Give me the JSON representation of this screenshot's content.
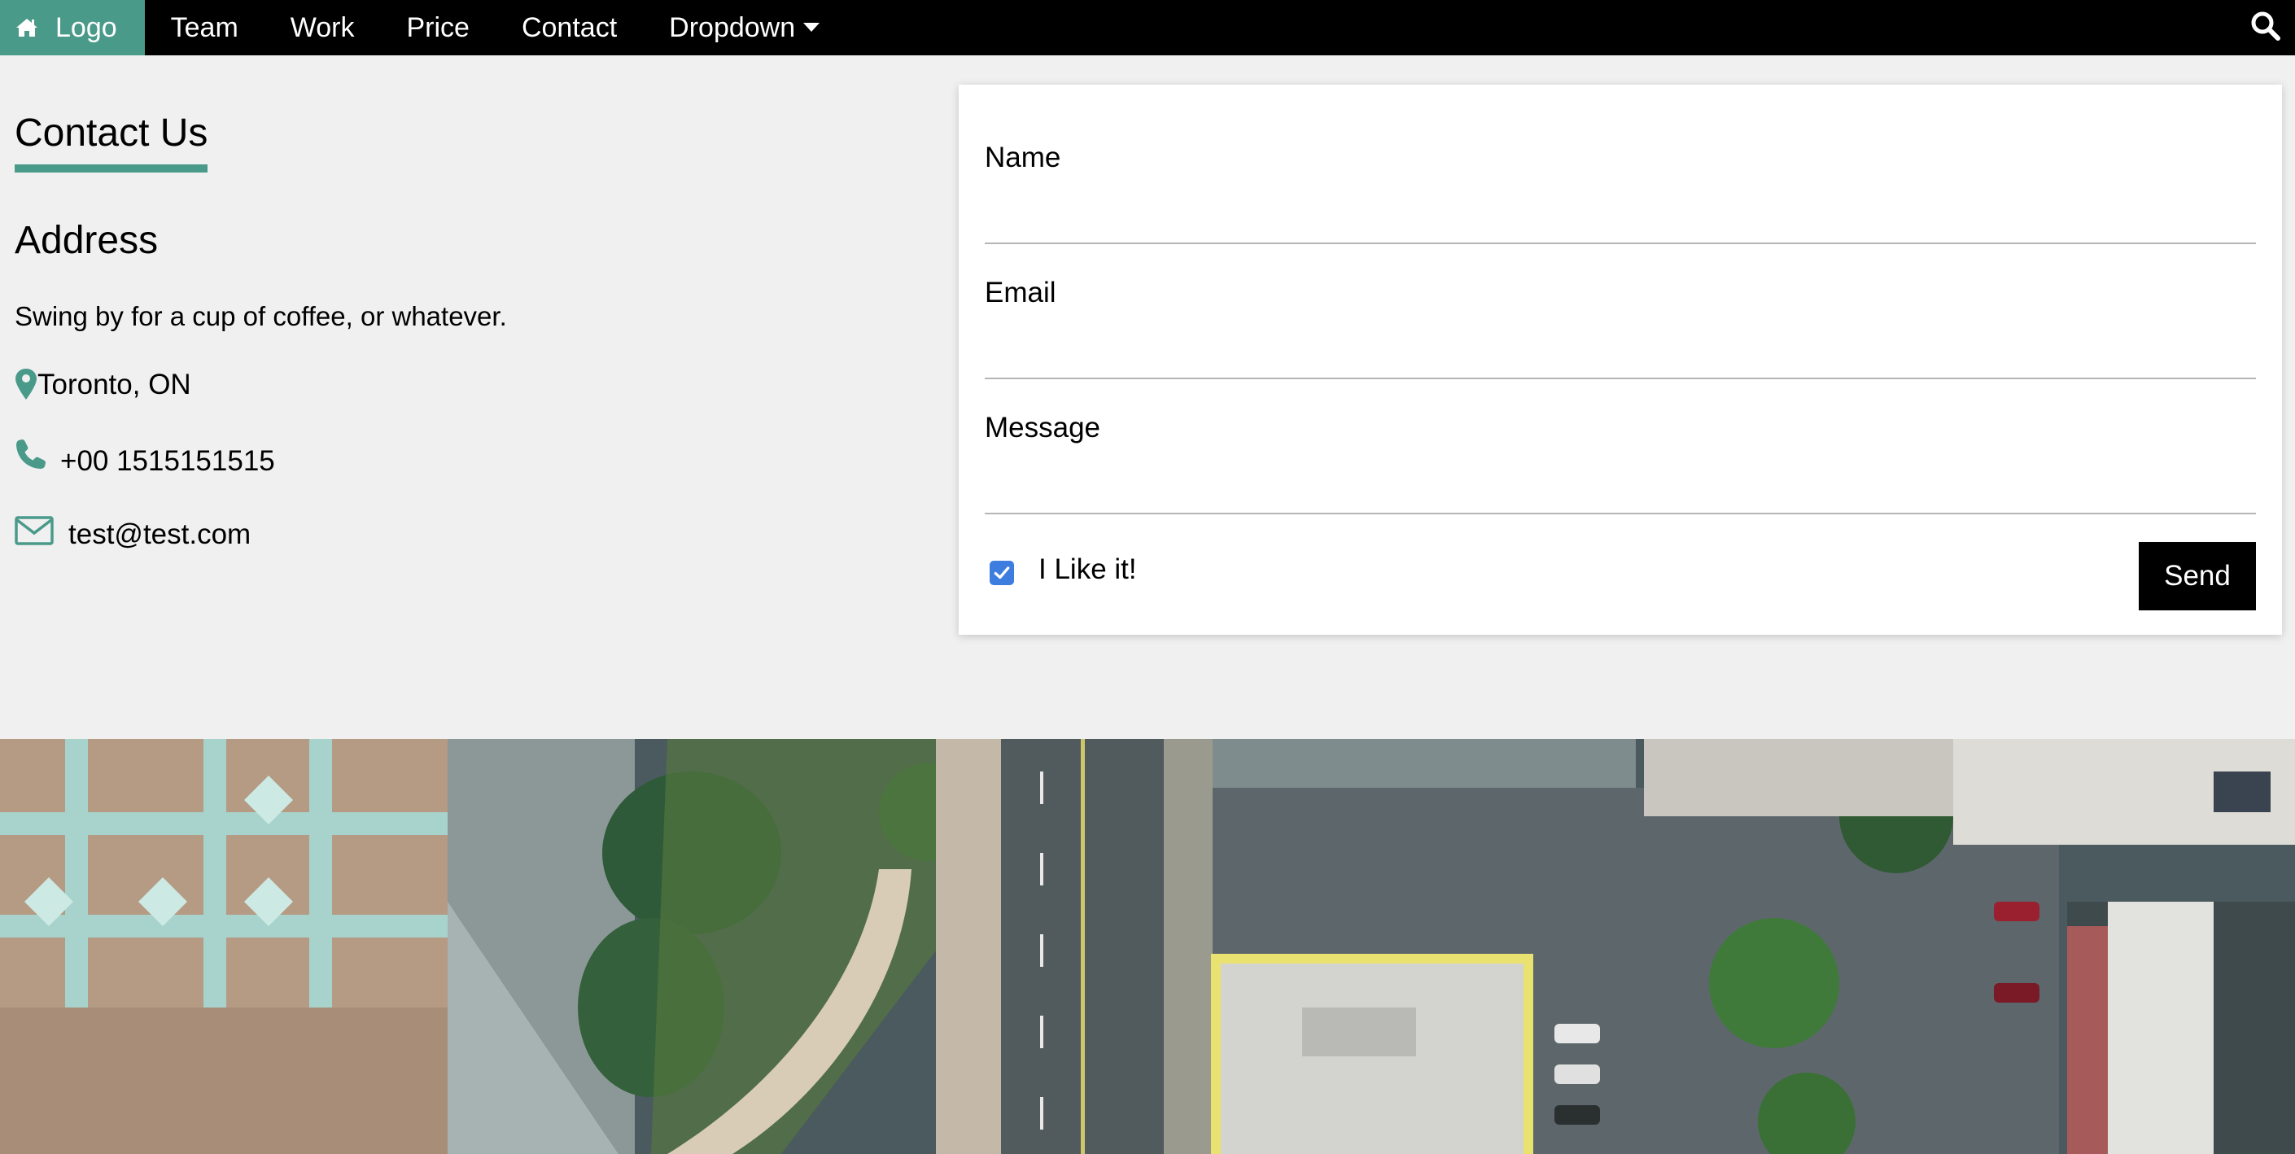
{
  "nav": {
    "logo_label": "Logo",
    "items": [
      {
        "label": "Team"
      },
      {
        "label": "Work"
      },
      {
        "label": "Price"
      },
      {
        "label": "Contact"
      },
      {
        "label": "Dropdown"
      }
    ]
  },
  "contact": {
    "title": "Contact Us",
    "address_heading": "Address",
    "description": "Swing by for a cup of coffee, or whatever.",
    "location": "Toronto, ON",
    "phone": "+00 1515151515",
    "email": "test@test.com"
  },
  "form": {
    "name_label": "Name",
    "name_value": "",
    "email_label": "Email",
    "email_value": "",
    "message_label": "Message",
    "message_value": "",
    "checkbox_label": "I Like it!",
    "checkbox_checked": true,
    "send_label": "Send"
  },
  "colors": {
    "accent": "#4a9a8a",
    "nav_bg": "#000000",
    "page_bg": "#f0f0f0",
    "checkbox": "#3e7de0"
  },
  "icons": [
    "home-icon",
    "search-icon",
    "map-marker-icon",
    "phone-icon",
    "envelope-icon",
    "caret-down-icon",
    "check-icon"
  ]
}
